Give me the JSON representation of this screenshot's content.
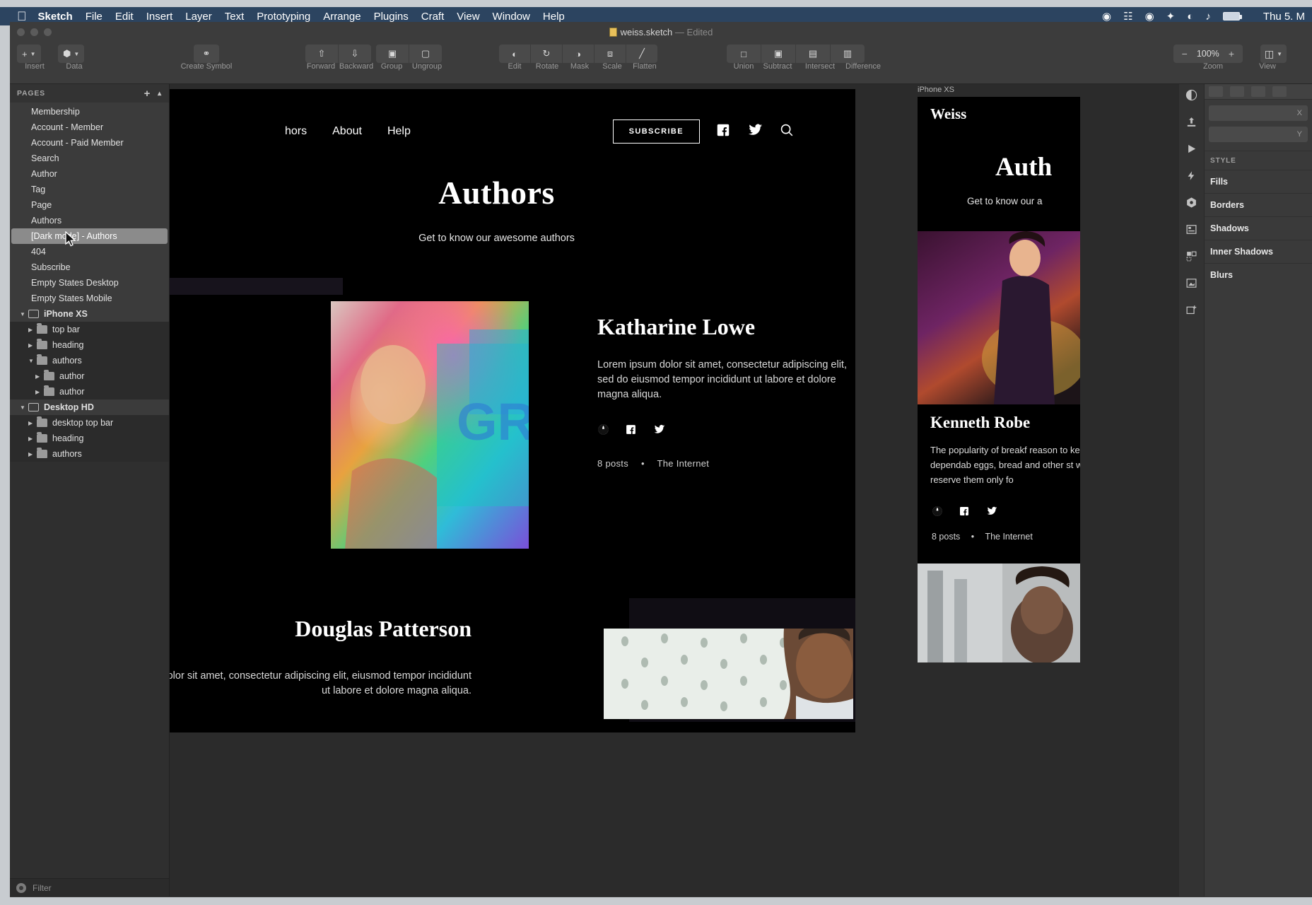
{
  "menubar": {
    "apple": "",
    "items": [
      "Sketch",
      "File",
      "Edit",
      "Insert",
      "Layer",
      "Text",
      "Prototyping",
      "Arrange",
      "Plugins",
      "Craft",
      "View",
      "Window",
      "Help"
    ],
    "status_icons": [
      "record-icon",
      "screen-share-icon",
      "clock-icon",
      "dropbox-icon",
      "wifi-icon",
      "volume-icon",
      "battery-icon"
    ],
    "clock": "Thu 5. M"
  },
  "window": {
    "document_title": "weiss.sketch",
    "document_state": "— Edited"
  },
  "toolbar": {
    "insert_label": "Insert",
    "data_label": "Data",
    "create_symbol_label": "Create Symbol",
    "forward_label": "Forward",
    "backward_label": "Backward",
    "group_label": "Group",
    "ungroup_label": "Ungroup",
    "edit_label": "Edit",
    "rotate_label": "Rotate",
    "mask_label": "Mask",
    "scale_label": "Scale",
    "flatten_label": "Flatten",
    "union_label": "Union",
    "subtract_label": "Subtract",
    "intersect_label": "Intersect",
    "difference_label": "Difference",
    "zoom_label": "Zoom",
    "zoom_value": "100%",
    "zoom_minus": "−",
    "zoom_plus": "+",
    "view_label": "View"
  },
  "pages_panel": {
    "header": "PAGES",
    "add_label": "+",
    "items": [
      {
        "label": "Membership",
        "selected": false
      },
      {
        "label": "Account - Member",
        "selected": false
      },
      {
        "label": "Account - Paid Member",
        "selected": false
      },
      {
        "label": "Search",
        "selected": false
      },
      {
        "label": "Author",
        "selected": false
      },
      {
        "label": "Tag",
        "selected": false
      },
      {
        "label": "Page",
        "selected": false
      },
      {
        "label": "Authors",
        "selected": false
      },
      {
        "label": "[Dark mode] - Authors",
        "selected": true
      },
      {
        "label": "404",
        "selected": false
      },
      {
        "label": "Subscribe",
        "selected": false
      },
      {
        "label": "Empty States Desktop",
        "selected": false
      },
      {
        "label": "Empty States Mobile",
        "selected": false
      }
    ]
  },
  "layers_panel": {
    "groups": [
      {
        "artboard": "iPhone XS",
        "children": [
          {
            "label": "top bar",
            "depth": 1,
            "expanded": false
          },
          {
            "label": "heading",
            "depth": 1,
            "expanded": false
          },
          {
            "label": "authors",
            "depth": 1,
            "expanded": true
          },
          {
            "label": "author",
            "depth": 2,
            "expanded": false
          },
          {
            "label": "author",
            "depth": 2,
            "expanded": false
          }
        ]
      },
      {
        "artboard": "Desktop HD",
        "children": [
          {
            "label": "desktop top bar",
            "depth": 1,
            "expanded": false
          },
          {
            "label": "heading",
            "depth": 1,
            "expanded": false
          },
          {
            "label": "authors",
            "depth": 1,
            "expanded": false
          }
        ]
      }
    ],
    "filter_placeholder": "Filter"
  },
  "canvas": {
    "desktop_artboard": {
      "nav_links": [
        "hors",
        "About",
        "Help"
      ],
      "subscribe_label": "SUBSCRIBE",
      "nav_icons": [
        "facebook-icon",
        "twitter-icon",
        "search-icon"
      ],
      "page_title": "Authors",
      "page_subtitle": "Get to know our awesome authors",
      "authors": [
        {
          "name": "Katharine Lowe",
          "bio": "Lorem ipsum dolor sit amet, consectetur adipiscing elit, sed do eiusmod tempor incididunt ut labore et dolore magna aliqua.",
          "social": [
            "globe-icon",
            "facebook-icon",
            "twitter-icon"
          ],
          "posts": "8 posts",
          "separator": "•",
          "location": "The Internet"
        },
        {
          "name": "Douglas Patterson",
          "bio": "um dolor sit amet, consectetur adipiscing elit, eiusmod tempor incididunt ut labore et dolore magna aliqua.",
          "social": [],
          "posts": "",
          "separator": "",
          "location": ""
        }
      ]
    },
    "phone_artboard": {
      "label": "iPhone XS",
      "brand": "Weiss",
      "page_title": "Auth",
      "page_subtitle": "Get to know our a",
      "author_name": "Kenneth Robe",
      "author_bio": "The popularity of breakf reason to keep dependab eggs, bread and other st why reserve them only fo",
      "posts": "8 posts",
      "separator": "•",
      "location": "The Internet"
    }
  },
  "inspector": {
    "field_x_label": "X",
    "field_y_label": "Y",
    "style_title": "STYLE",
    "rows": [
      "Fills",
      "Borders",
      "Shadows",
      "Inner Shadows",
      "Blurs"
    ],
    "rail_icons": [
      "contrast-icon",
      "export-icon",
      "play-icon",
      "lightning-icon",
      "component-icon",
      "layout-icon",
      "grid-icon",
      "image-icon",
      "add-image-icon"
    ]
  },
  "colors": {
    "menubar_bg": "#2c4460",
    "window_chrome": "#3c3c3c",
    "panel_bg": "#333333",
    "canvas_bg": "#2b2b2b",
    "artboard_bg": "#000000",
    "selection": "#8b8b8b"
  }
}
